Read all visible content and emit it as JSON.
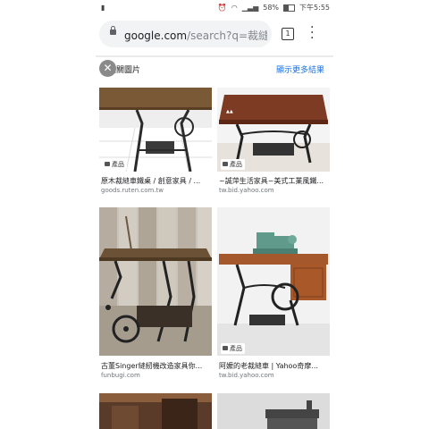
{
  "status": {
    "left_icon": "notification-icon",
    "battery_percent": "58%",
    "time": "下午5:55"
  },
  "browser": {
    "url_domain": "google.com",
    "url_path": "/search?q=裁縫車",
    "tab_count": "1"
  },
  "images_section": {
    "title": "相關圖片",
    "more_label": "顯示更多結果"
  },
  "results": [
    {
      "badge": "產品",
      "title": "原木裁縫車鐵桌 / 創意家具 / ...",
      "source": "goods.ruten.com.tw"
    },
    {
      "badge": "產品",
      "title": "~誠萍生活家具~美式工業風鐵...",
      "source": "tw.bid.yahoo.com"
    },
    {
      "title": "古董Singer縫紉機改造家具你...",
      "source": "funbugi.com"
    },
    {
      "badge": "產品",
      "title": "阿嬤的老裁縫車 | Yahoo奇摩...",
      "source": "tw.bid.yahoo.com"
    }
  ]
}
